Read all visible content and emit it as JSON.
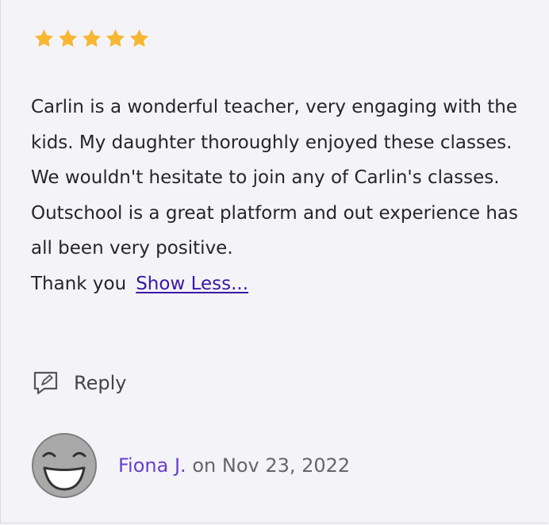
{
  "review": {
    "rating": 5,
    "rating_max": 5,
    "paragraphs": [
      "Carlin is a wonderful teacher, very engaging with the kids. My daughter thoroughly enjoyed these classes. We wouldn't hesitate to join any of Carlin's classes.",
      "Outschool is a great platform and out experience has all been very positive."
    ],
    "last_line": "Thank you",
    "show_less_label": "Show Less..."
  },
  "reply": {
    "label": "Reply",
    "icon": "reply-icon"
  },
  "author": {
    "name": "Fiona J.",
    "date_prefix": "on",
    "date": "Nov 23, 2022",
    "avatar_icon": "smiley-avatar"
  },
  "colors": {
    "star": "#f7b733",
    "link": "#3a18a6",
    "author_name": "#6a3fce",
    "background": "#f4f4f8"
  }
}
